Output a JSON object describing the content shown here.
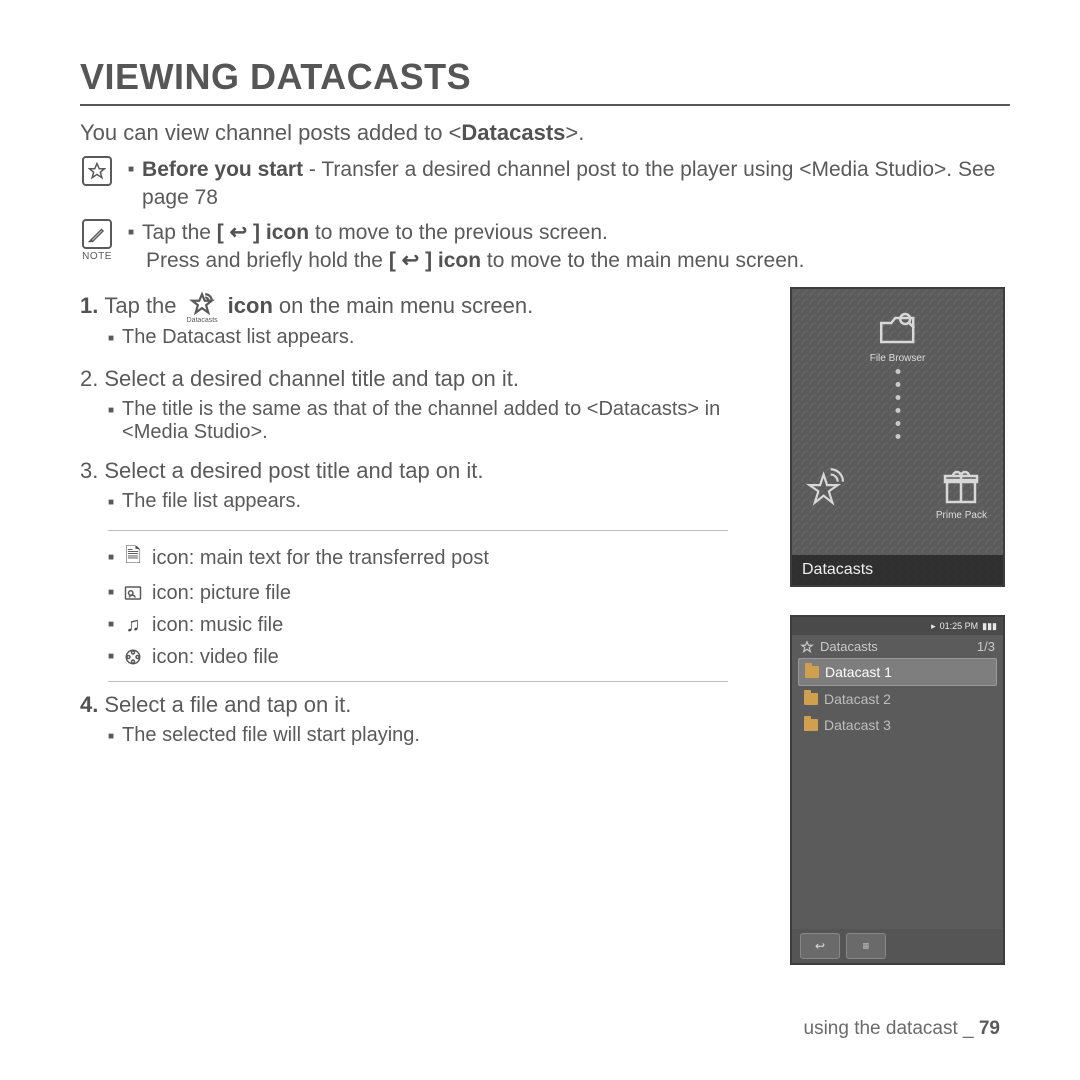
{
  "title": "VIEWING DATACASTS",
  "intro_prefix": "You can view channel posts added to <",
  "intro_bold": "Datacasts",
  "intro_suffix": ">.",
  "star_callout": {
    "bold": "Before you start",
    "text": " - Transfer a desired channel post to the player using <Media Studio>. See page 78"
  },
  "note_label": "NOTE",
  "note_callout": {
    "line1_a": "Tap the ",
    "line1_b": "[ ↩ ] icon",
    "line1_c": " to move to the previous screen.",
    "line2_a": "Press and briefly hold the ",
    "line2_b": "[ ↩ ] icon",
    "line2_c": " to move to the main menu screen."
  },
  "steps": {
    "s1_num": "1.",
    "s1_a": "Tap the ",
    "s1_icon_label": "Datacasts",
    "s1_b": "icon",
    "s1_c": " on the main menu screen.",
    "s1_sub": "The Datacast list appears.",
    "s2_num": "2.",
    "s2": "Select a desired channel title and tap on it.",
    "s2_sub": "The title is the same as that of the channel added to <Datacasts> in <Media Studio>.",
    "s3_num": "3.",
    "s3": "Select a desired post title and tap on it.",
    "s3_sub": "The file list appears.",
    "icon_list": {
      "doc": "icon: main text for the transferred post",
      "pic": "icon: picture file",
      "music": "icon: music file",
      "video": "icon: video file"
    },
    "s4_num": "4.",
    "s4": "Select a file and tap on it.",
    "s4_sub": "The selected file will start playing."
  },
  "device1": {
    "app_file_browser": "File Browser",
    "app_prime_pack": "Prime Pack",
    "banner": "Datacasts"
  },
  "device2": {
    "time": "01:25 PM",
    "crumb": "Datacasts",
    "counter": "1/3",
    "items": [
      "Datacast 1",
      "Datacast 2",
      "Datacast 3"
    ]
  },
  "footer": {
    "text": "using the datacast _ ",
    "page": "79"
  }
}
